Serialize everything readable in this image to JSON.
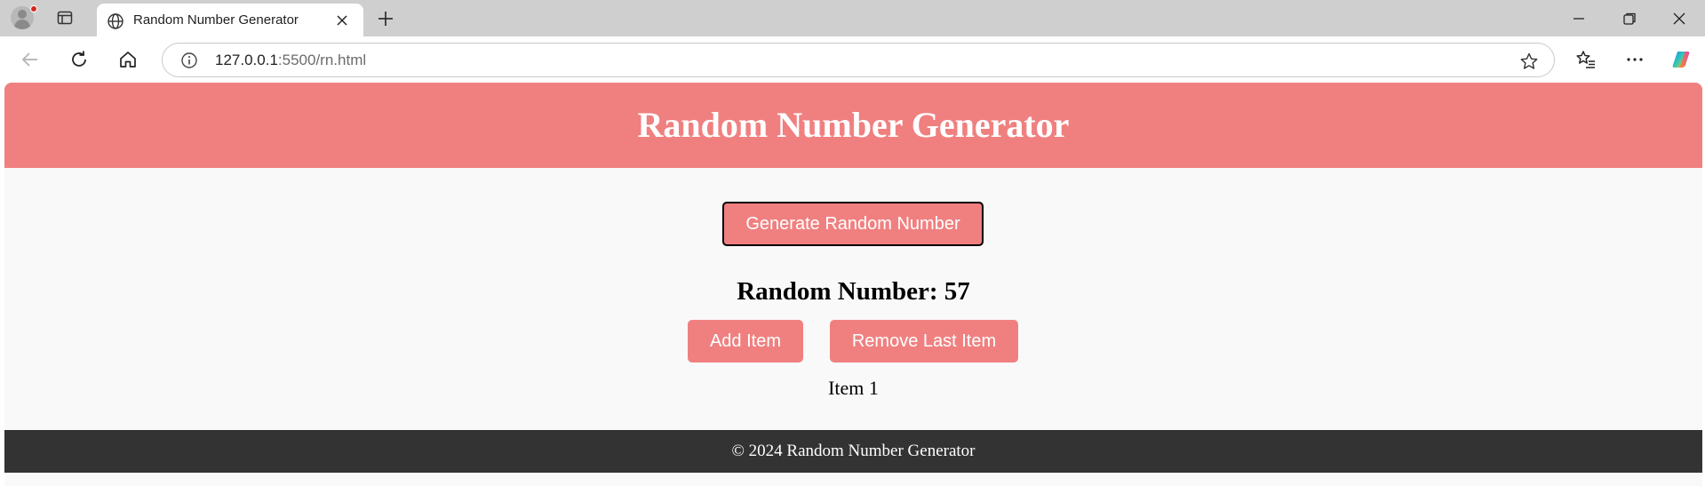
{
  "browser": {
    "tab_title": "Random Number Generator",
    "url_host": "127.0.0.1",
    "url_path": ":5500/rn.html"
  },
  "page": {
    "heading": "Random Number Generator",
    "generate_label": "Generate Random Number",
    "result_text": "Random Number: 57",
    "add_label": "Add Item",
    "remove_label": "Remove Last Item",
    "items": [
      "Item 1"
    ],
    "footer": "© 2024 Random Number Generator"
  },
  "colors": {
    "accent": "#f08080",
    "footer_bg": "#333333",
    "page_bg": "#f9f9f9"
  }
}
